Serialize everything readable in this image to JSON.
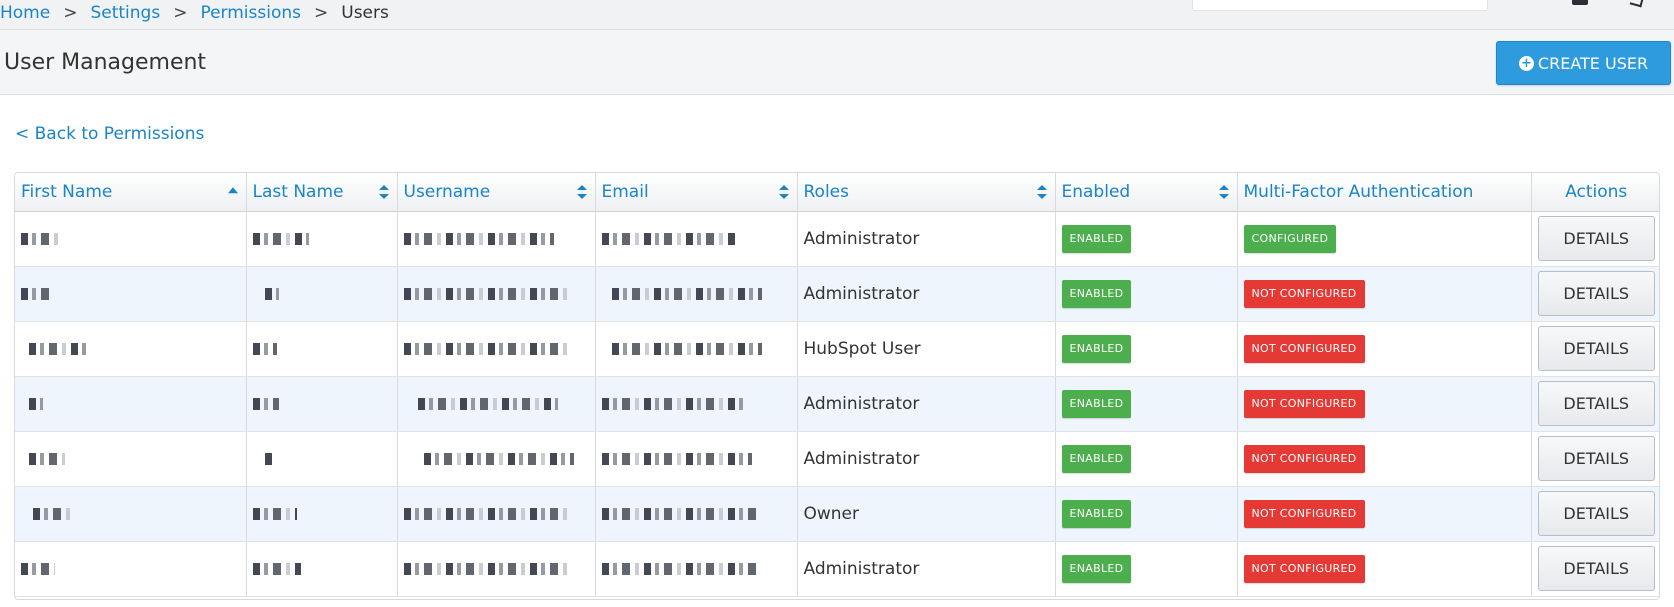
{
  "breadcrumb": {
    "items": [
      "Home",
      "Settings",
      "Permissions"
    ],
    "current": "Users",
    "separator": ">"
  },
  "header": {
    "title": "User Management",
    "create_label": "CREATE USER"
  },
  "back_link": "< Back to Permissions",
  "table": {
    "columns": {
      "first_name": "First Name",
      "last_name": "Last Name",
      "username": "Username",
      "email": "Email",
      "roles": "Roles",
      "enabled": "Enabled",
      "mfa": "Multi-Factor Authentication",
      "actions": "Actions"
    },
    "details_label": "DETAILS",
    "rows": [
      {
        "role": "Administrator",
        "enabled": "ENABLED",
        "mfa": "CONFIGURED"
      },
      {
        "role": "Administrator",
        "enabled": "ENABLED",
        "mfa": "NOT CONFIGURED"
      },
      {
        "role": "HubSpot User",
        "enabled": "ENABLED",
        "mfa": "NOT CONFIGURED"
      },
      {
        "role": "Administrator",
        "enabled": "ENABLED",
        "mfa": "NOT CONFIGURED"
      },
      {
        "role": "Administrator",
        "enabled": "ENABLED",
        "mfa": "NOT CONFIGURED"
      },
      {
        "role": "Owner",
        "enabled": "ENABLED",
        "mfa": "NOT CONFIGURED"
      },
      {
        "role": "Administrator",
        "enabled": "ENABLED",
        "mfa": "NOT CONFIGURED"
      }
    ]
  },
  "colors": {
    "link": "#1a84c8",
    "primary_button": "#2e9bdf",
    "enabled_badge": "#4cae4c",
    "configured_badge": "#4cae4c",
    "not_configured_badge": "#e53935",
    "row_stripe": "#eef5fd"
  },
  "icons": {
    "create_button": "plus-circle-icon",
    "sort": "sort-icon",
    "sort_ascending": "sort-ascending-icon"
  }
}
